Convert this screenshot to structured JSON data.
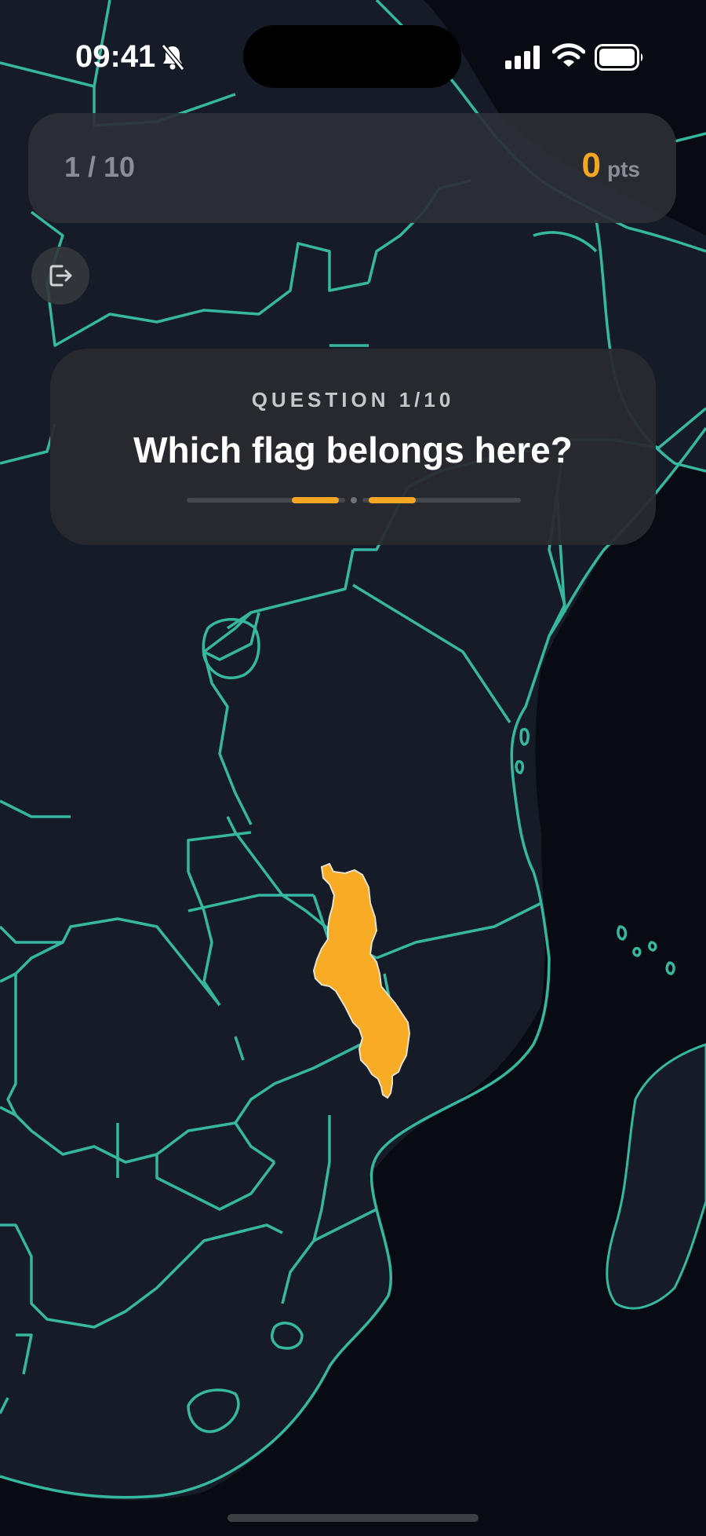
{
  "status_bar": {
    "time": "09:41",
    "icons": [
      "bell-slash-icon",
      "cellular-signal-icon",
      "wifi-icon",
      "battery-icon"
    ]
  },
  "score_bar": {
    "progress": "1 / 10",
    "score": "0",
    "score_unit": "pts"
  },
  "exit_button": {
    "icon": "exit-icon"
  },
  "question_card": {
    "label": "QUESTION 1/10",
    "title": "Which flag belongs here?"
  },
  "map": {
    "border_color": "#36b8a0",
    "land_color": "#151b27",
    "ocean_color": "#090b12",
    "highlight_color": "#f8ab24"
  },
  "colors": {
    "accent": "#f5a623",
    "card_background": "#2c2f34",
    "muted_text": "#8a8d93"
  }
}
